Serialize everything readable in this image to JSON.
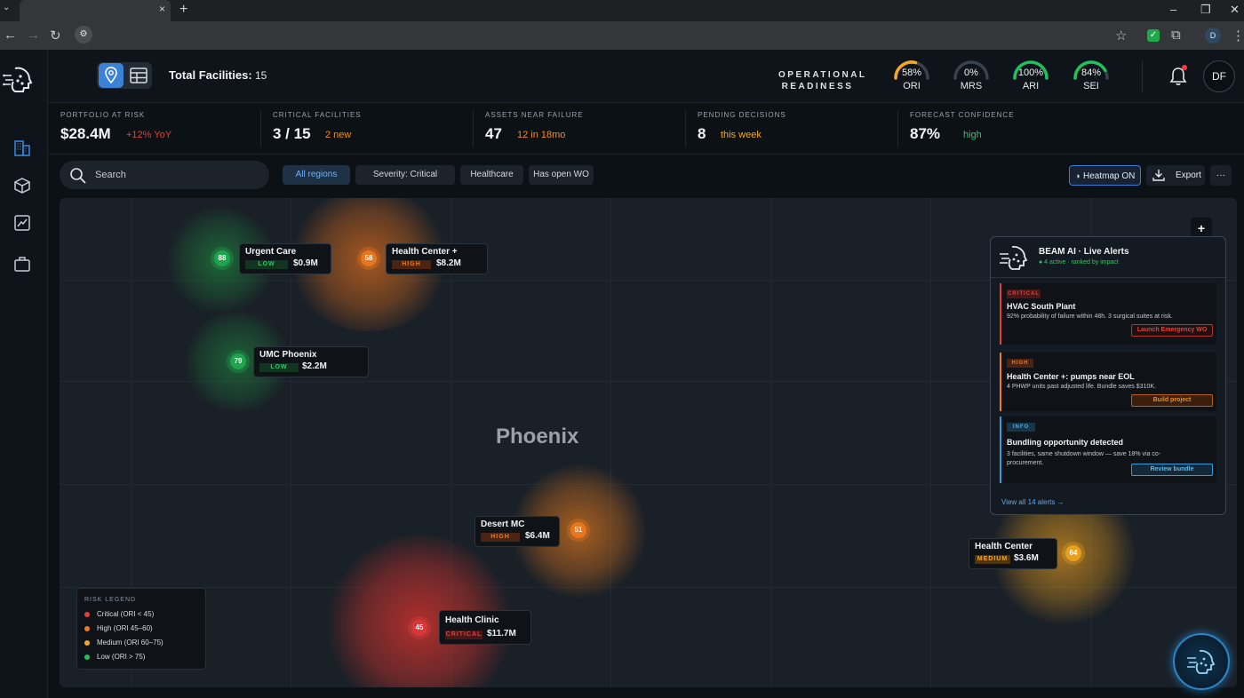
{
  "browser": {
    "new_tab": "+",
    "tab_close": "×",
    "profile_initial": "D"
  },
  "topbar": {
    "total_label": "Total Facilities:",
    "total_value": "15",
    "op_readiness_line1": "OPERATIONAL",
    "op_readiness_line2": "READINESS",
    "gauges": [
      {
        "value": "58%",
        "label": "ORI",
        "percent": 58,
        "color": "#f5a623"
      },
      {
        "value": "0%",
        "label": "MRS",
        "percent": 0,
        "color": "#7d8794"
      },
      {
        "value": "100%",
        "label": "ARI",
        "percent": 100,
        "color": "#1fc15a"
      },
      {
        "value": "84%",
        "label": "SEI",
        "percent": 84,
        "color": "#1fc15a"
      }
    ],
    "avatar": "DF"
  },
  "kpis": [
    {
      "label": "PORTFOLIO AT RISK",
      "value": "$28.4M",
      "sub": "+12% YoY",
      "sub_color": "#e0413a"
    },
    {
      "label": "CRITICAL FACILITIES",
      "value": "3 / 15",
      "sub": "2 new",
      "sub_color": "#f08a24"
    },
    {
      "label": "ASSETS NEAR FAILURE",
      "value": "47",
      "sub": "12 in 18mo",
      "sub_color": "#f08a24"
    },
    {
      "label": "PENDING DECISIONS",
      "value": "8",
      "sub": "this week",
      "sub_color": "#f5a623"
    },
    {
      "label": "FORECAST CONFIDENCE",
      "value": "87%",
      "sub": "high",
      "sub_color": "#2ec866"
    }
  ],
  "filters": {
    "search_placeholder": "Search",
    "chips": [
      "All regions",
      "Severity: Critical",
      "Healthcare",
      "Has open WO"
    ],
    "heatmap": "Heatmap ON",
    "export": "Export",
    "more": "···"
  },
  "map": {
    "city": "Phoenix",
    "facilities": [
      {
        "name": "Urgent Care",
        "score": "88",
        "risk": "LOW",
        "cost": "$0.9M"
      },
      {
        "name": "Health Center +",
        "score": "58",
        "risk": "HIGH",
        "cost": "$8.2M"
      },
      {
        "name": "UMC Phoenix",
        "score": "79",
        "risk": "LOW",
        "cost": "$2.2M"
      },
      {
        "name": "Desert MC",
        "score": "51",
        "risk": "HIGH",
        "cost": "$6.4M"
      },
      {
        "name": "Health Center",
        "score": "64",
        "risk": "MEDIUM",
        "cost": "$3.6M"
      },
      {
        "name": "Health Clinic",
        "score": "45",
        "risk": "CRITICAL",
        "cost": "$11.7M"
      }
    ],
    "legend": {
      "title": "RISK LEGEND",
      "items": [
        {
          "label": "Critical (ORI < 45)",
          "color": "#e0413a"
        },
        {
          "label": "High (ORI 45–60)",
          "color": "#f07a1e"
        },
        {
          "label": "Medium (ORI 60–75)",
          "color": "#f5a623"
        },
        {
          "label": "Low (ORI > 75)",
          "color": "#1fc15a"
        }
      ]
    },
    "zoom_in": "+"
  },
  "alerts": {
    "title": "BEAM AI · Live Alerts",
    "subtitle": "● 4 active · ranked by impact",
    "items": [
      {
        "tag": "CRITICAL",
        "title": "HVAC South Plant",
        "desc": "92% probability of failure within 48h. 3 surgical suites at risk.",
        "action": "Launch Emergency WO"
      },
      {
        "tag": "HIGH",
        "title": "Health Center +: pumps near EOL",
        "desc": "4 PHWP units past adjusted life. Bundle saves $310K.",
        "action": "Build project"
      },
      {
        "tag": "INFO",
        "title": "Bundling opportunity detected",
        "desc": "3 facilities, same shutdown window — save 18% via co-procurement.",
        "action": "Review bundle"
      }
    ],
    "view_all": "View all 14 alerts →"
  }
}
